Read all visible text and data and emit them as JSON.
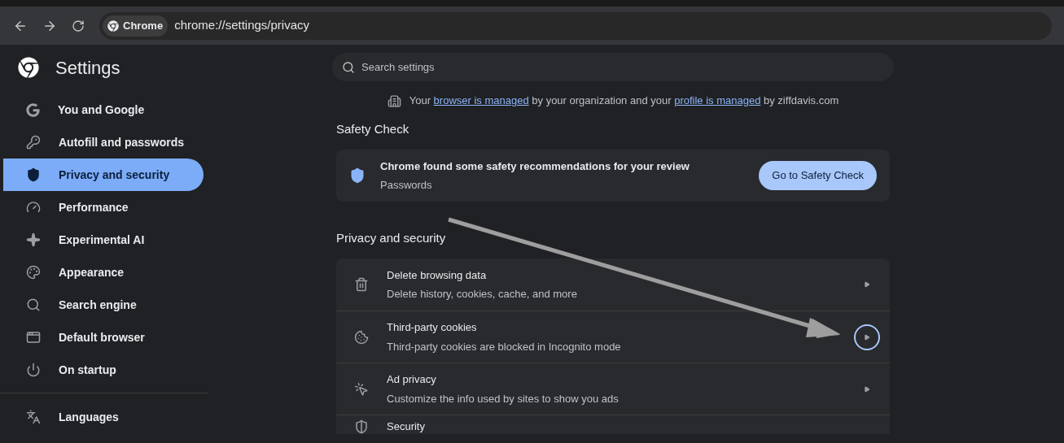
{
  "toolbar": {
    "chip": "Chrome",
    "url": "chrome://settings/privacy"
  },
  "sidebar": {
    "title": "Settings",
    "groups": [
      [
        {
          "kind": "google",
          "label": "You and Google",
          "selected": false
        },
        {
          "kind": "key",
          "label": "Autofill and passwords",
          "selected": false
        },
        {
          "kind": "shield",
          "label": "Privacy and security",
          "selected": true
        },
        {
          "kind": "gauge",
          "label": "Performance",
          "selected": false
        },
        {
          "kind": "sparkle",
          "label": "Experimental AI",
          "selected": false
        },
        {
          "kind": "palette",
          "label": "Appearance",
          "selected": false
        },
        {
          "kind": "search",
          "label": "Search engine",
          "selected": false
        },
        {
          "kind": "window",
          "label": "Default browser",
          "selected": false
        },
        {
          "kind": "power",
          "label": "On startup",
          "selected": false
        }
      ],
      [
        {
          "kind": "translate",
          "label": "Languages",
          "selected": false
        }
      ]
    ]
  },
  "search": {
    "placeholder": "Search settings"
  },
  "notice": [
    {
      "text": "Your ",
      "link": false
    },
    {
      "text": "browser is managed",
      "link": true
    },
    {
      "text": " by your organization and your ",
      "link": false
    },
    {
      "text": "profile is managed",
      "link": true
    },
    {
      "text": " by ziffdavis.com",
      "link": false
    }
  ],
  "safety_check": {
    "heading": "Safety Check",
    "title": "Chrome found some safety recommendations for your review",
    "subtitle": "Passwords",
    "button": "Go to Safety Check"
  },
  "privacy": {
    "heading": "Privacy and security",
    "rows": [
      {
        "kind": "trash",
        "title": "Delete browsing data",
        "subtitle": "Delete history, cookies, cache, and more",
        "focused": false
      },
      {
        "kind": "cookie",
        "title": "Third-party cookies",
        "subtitle": "Third-party cookies are blocked in Incognito mode",
        "focused": true
      },
      {
        "kind": "target",
        "title": "Ad privacy",
        "subtitle": "Customize the info used by sites to show you ads",
        "focused": false
      },
      {
        "kind": "shield",
        "title": "Security",
        "focused": false
      }
    ]
  }
}
